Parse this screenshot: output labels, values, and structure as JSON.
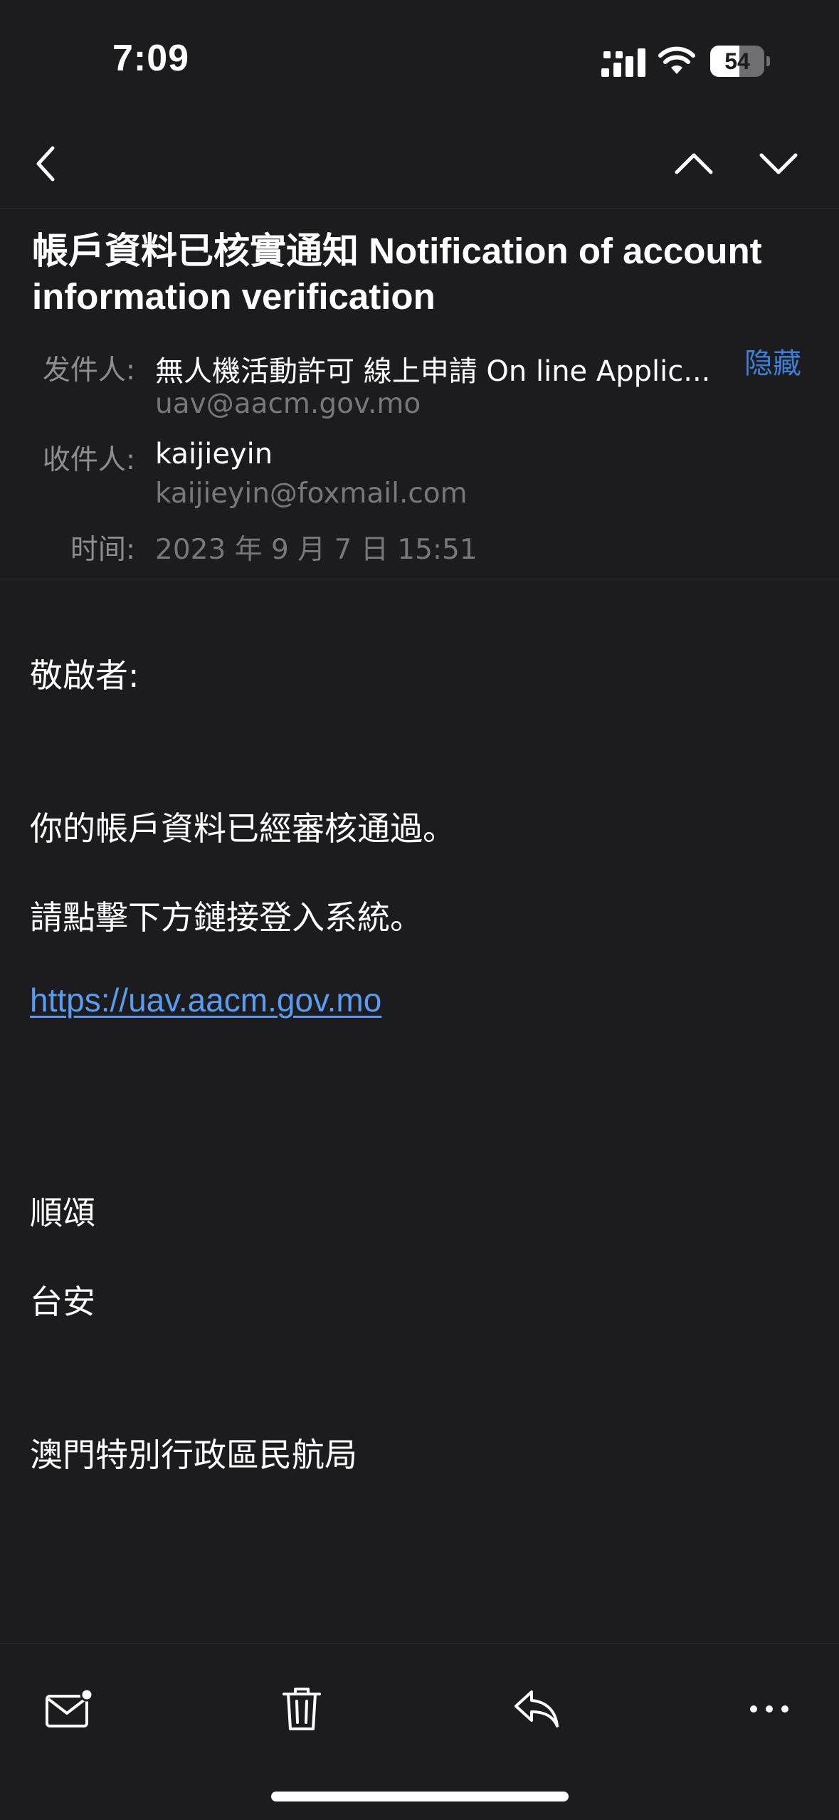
{
  "status_bar": {
    "time": "7:09",
    "battery": "54",
    "battery_level": 0.54
  },
  "header": {
    "subject": "帳戶資料已核實通知 Notification of account information verification",
    "from_label": "发件人:",
    "from_name": "無人機活動許可 線上申請 On line Applic...",
    "from_address": "uav@aacm.gov.mo",
    "hide_label": "隐藏",
    "to_label": "收件人:",
    "to_name": "kaijieyin",
    "to_address": "kaijieyin@foxmail.com",
    "time_label": "时间:",
    "time_value": "2023 年 9 月 7 日 15:51"
  },
  "body": {
    "greeting": "敬啟者:",
    "line1": "你的帳戶資料已經審核通過。",
    "line2": "請點擊下方鏈接登入系統。",
    "link": "https://uav.aacm.gov.mo",
    "closing1": "順頌",
    "closing2": "台安",
    "signature": "澳門特別行政區民航局"
  },
  "icons": {
    "back": "chevron-left-icon",
    "prev": "chevron-up-icon",
    "next": "chevron-down-icon",
    "mark_unread": "envelope-icon",
    "delete": "trash-icon",
    "reply": "reply-icon",
    "more": "ellipsis-icon"
  },
  "colors": {
    "background": "#1c1c1e",
    "link": "#5a9cf0",
    "accent": "#3d7fd6",
    "secondary_text": "#8d8d92"
  }
}
